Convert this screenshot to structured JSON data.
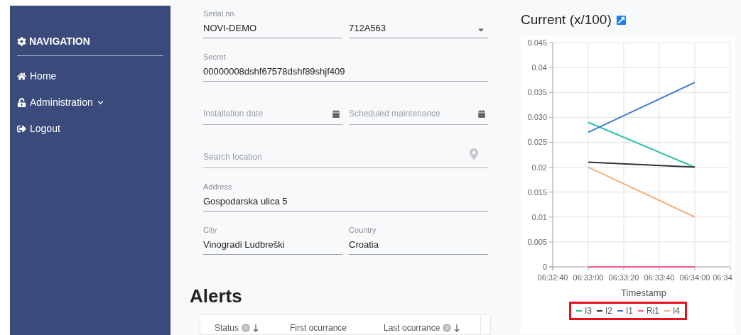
{
  "sidebar": {
    "title": "NAVIGATION",
    "items": [
      {
        "label": "Home",
        "has_submenu": false
      },
      {
        "label": "Administration",
        "has_submenu": true
      },
      {
        "label": "Logout",
        "has_submenu": false
      }
    ]
  },
  "form": {
    "rows": [
      [
        {
          "kind": "text",
          "label": "Serial no.",
          "value": "NOVI-DEMO"
        },
        {
          "kind": "select",
          "value": "712A563"
        }
      ],
      [
        {
          "kind": "text",
          "label": "Secret",
          "value": "00000008dshf67578dshf89shjf409"
        }
      ],
      [
        {
          "kind": "date",
          "placeholder": "Installation date"
        },
        {
          "kind": "date",
          "placeholder": "Scheduled maintenance"
        }
      ],
      [
        {
          "kind": "location",
          "placeholder": "Search location"
        }
      ],
      [
        {
          "kind": "text",
          "label": "Address",
          "value": "Gospodarska ulica 5"
        }
      ],
      [
        {
          "kind": "text",
          "label": "City",
          "value": "Vinogradi Ludbreški"
        },
        {
          "kind": "text",
          "label": "Country",
          "value": "Croatia"
        }
      ]
    ]
  },
  "alerts": {
    "title": "Alerts",
    "columns": [
      {
        "label": "Status",
        "sort_rank": "1",
        "sorted": true
      },
      {
        "label": "First ocurrance",
        "sorted": false
      },
      {
        "label": "Last ocurrance",
        "sort_rank": "2",
        "sorted": true
      }
    ]
  },
  "current_chart": {
    "title": "Current (x/100)",
    "legend_highlighted": true,
    "chart_data": {
      "type": "line",
      "grid": true,
      "legend": "bottom",
      "xlabel": "Timestamp",
      "categories": [
        "06:32:40",
        "06:33:00",
        "06:33:20",
        "06:33:40",
        "06:34:00",
        "06:34"
      ],
      "ylim": [
        0,
        0.045
      ],
      "yticks": [
        {
          "value": 0,
          "label": "0"
        },
        {
          "value": 0.005,
          "label": "0.005"
        },
        {
          "value": 0.01,
          "label": "0.01"
        },
        {
          "value": 0.015,
          "label": "0.015"
        },
        {
          "value": 0.02,
          "label": "0.02"
        },
        {
          "value": 0.025,
          "label": "0.025"
        },
        {
          "value": 0.03,
          "label": "0.030"
        },
        {
          "value": 0.035,
          "label": "0.035"
        },
        {
          "value": 0.04,
          "label": "0.04"
        },
        {
          "value": 0.045,
          "label": "0.045"
        }
      ],
      "series": [
        {
          "name": "I3",
          "color": "#1fbf9f",
          "values": [
            null,
            0.029,
            null,
            null,
            0.02,
            null
          ]
        },
        {
          "name": "I2",
          "color": "#333333",
          "values": [
            null,
            0.021,
            null,
            null,
            0.02,
            null
          ]
        },
        {
          "name": "I1",
          "color": "#3a7bd5",
          "values": [
            null,
            0.027,
            null,
            null,
            0.037,
            null
          ]
        },
        {
          "name": "Ri1",
          "color": "#e8608e",
          "values": [
            null,
            0,
            null,
            null,
            0,
            null
          ]
        },
        {
          "name": "I4",
          "color": "#f5b07a",
          "values": [
            null,
            0.02,
            null,
            null,
            0.01,
            null
          ]
        }
      ]
    }
  }
}
